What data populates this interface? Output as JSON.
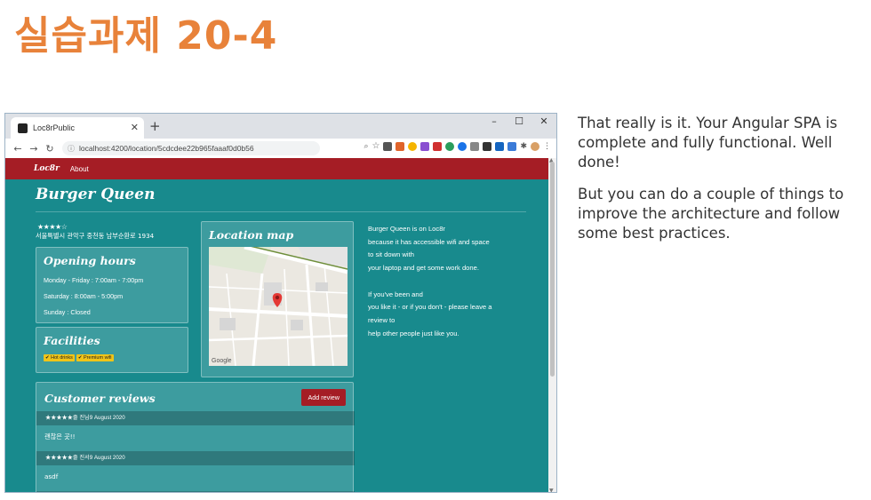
{
  "slide_title": "실습과제 20-4",
  "side_text": {
    "p1": "That really is it. Your Angular SPA is complete and fully functional. Well done!",
    "p2": "But you can do a couple of things to improve the architecture and follow some best practices."
  },
  "browser": {
    "tab_title": "Loc8rPublic",
    "url": "localhost:4200/location/5cdcdee22b965faaaf0d0b56",
    "window_controls": [
      "–",
      "☐",
      "✕"
    ]
  },
  "app": {
    "brand": "Loc8r",
    "nav_about": "About",
    "page_title": "Burger Queen",
    "rating_stars": "★★★★☆",
    "address": "서울특별시 관악구 중천동 남부순환로 1934",
    "opening_hours_title": "Opening hours",
    "hours": [
      "Monday - Friday : 7:00am - 7:00pm",
      "Saturday : 8:00am - 5:00pm",
      "Sunday : Closed"
    ],
    "facilities_title": "Facilities",
    "facilities": [
      "✔ Hot drinks",
      "✔ Premium wifi"
    ],
    "map_title": "Location map",
    "map_google": "Google",
    "about_lines": [
      "Burger Queen is on Loc8r",
      "because it has accessible wifi and space",
      "to sit down with",
      "your laptop and get some work done.",
      "",
      "If you've been and",
      "you like it - or if you don't - please leave a",
      "review to",
      "help other people just like you."
    ],
    "reviews_title": "Customer reviews",
    "add_review_label": "Add review",
    "reviews": [
      {
        "header": "★★★★★줄 진님9 August 2020",
        "text": "괜찮은 곳!!"
      },
      {
        "header": "★★★★★줄 진서9 August 2020",
        "text": "asdf"
      }
    ]
  },
  "colors": {
    "title_orange": "#e8823a",
    "page_teal": "#188a8d",
    "app_red": "#a51d25",
    "badge_yellow": "#f0c419"
  }
}
